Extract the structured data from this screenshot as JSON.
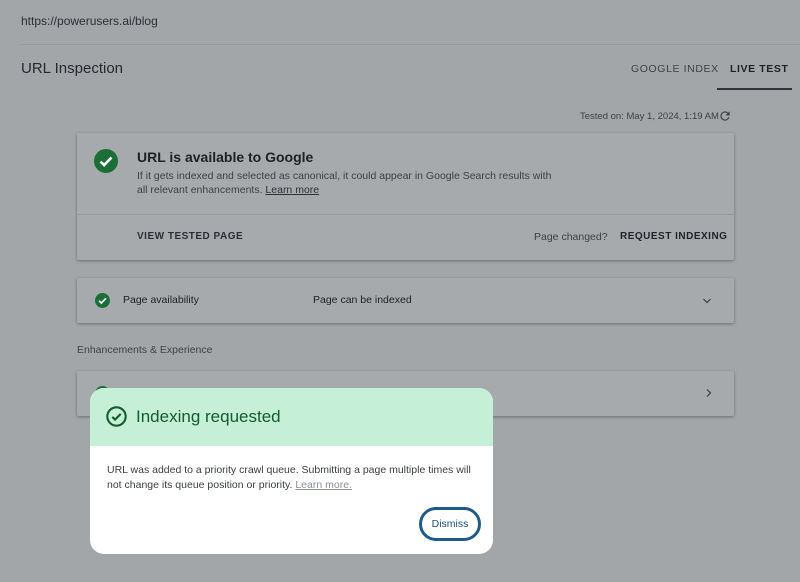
{
  "url": "https://powerusers.ai/blog",
  "page_title": "URL Inspection",
  "tabs": [
    {
      "label": "GOOGLE INDEX"
    },
    {
      "label": "LIVE TEST"
    }
  ],
  "tested_on": "Tested on: May 1, 2024, 1:19 AM",
  "main_card": {
    "title": "URL is available to Google",
    "description": "If it gets indexed and selected as canonical, it could appear in Google Search results with all relevant enhancements. ",
    "learn_more": "Learn more",
    "view_tested_page": "VIEW TESTED PAGE",
    "page_changed": "Page changed?",
    "request_indexing": "REQUEST INDEXING"
  },
  "availability": {
    "label": "Page availability",
    "value": "Page can be indexed"
  },
  "enhancements_label": "Enhancements & Experience",
  "dialog": {
    "title": "Indexing requested",
    "body": "URL was added to a priority crawl queue. Submitting a page multiple times will not change its queue position or priority. ",
    "learn_more": "Learn more.",
    "dismiss": "Dismiss"
  },
  "colors": {
    "success_green": "#1e8e3e",
    "dialog_header": "#c6efd7",
    "dismiss_outline": "#1d5b8c"
  }
}
